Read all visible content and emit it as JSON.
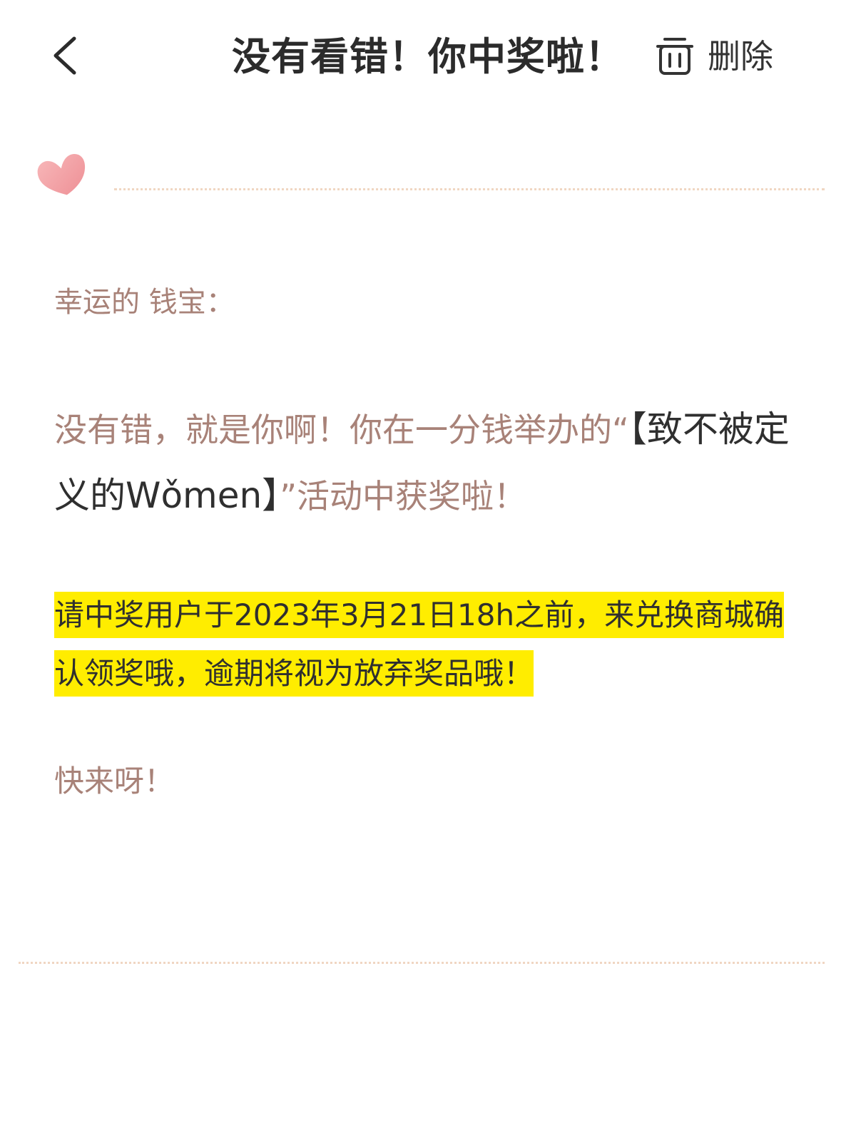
{
  "header": {
    "title": "没有看错！你中奖啦！",
    "delete_label": "删除",
    "back_icon": "chevron-left-icon",
    "delete_icon": "trash-icon"
  },
  "decoration": {
    "heart_icon": "heart-icon",
    "heart_color": "#f4a0a5",
    "divider_color": "#f0d6c2"
  },
  "body": {
    "greeting": "幸运的 钱宝：",
    "message_part1": "没有错，就是你啊！你在一分钱举办的“",
    "message_event": "【致不被定义的Wǒmen】",
    "message_part2": "”活动中获奖啦！",
    "notice": "请中奖用户于2023年3月21日18h之前，来兑换商城确认领奖哦，逾期将视为放弃奖品哦！",
    "closing": "快来呀！"
  },
  "colors": {
    "body_text": "#a88278",
    "dark_text": "#2f2f2f",
    "highlight": "#ffed00"
  }
}
